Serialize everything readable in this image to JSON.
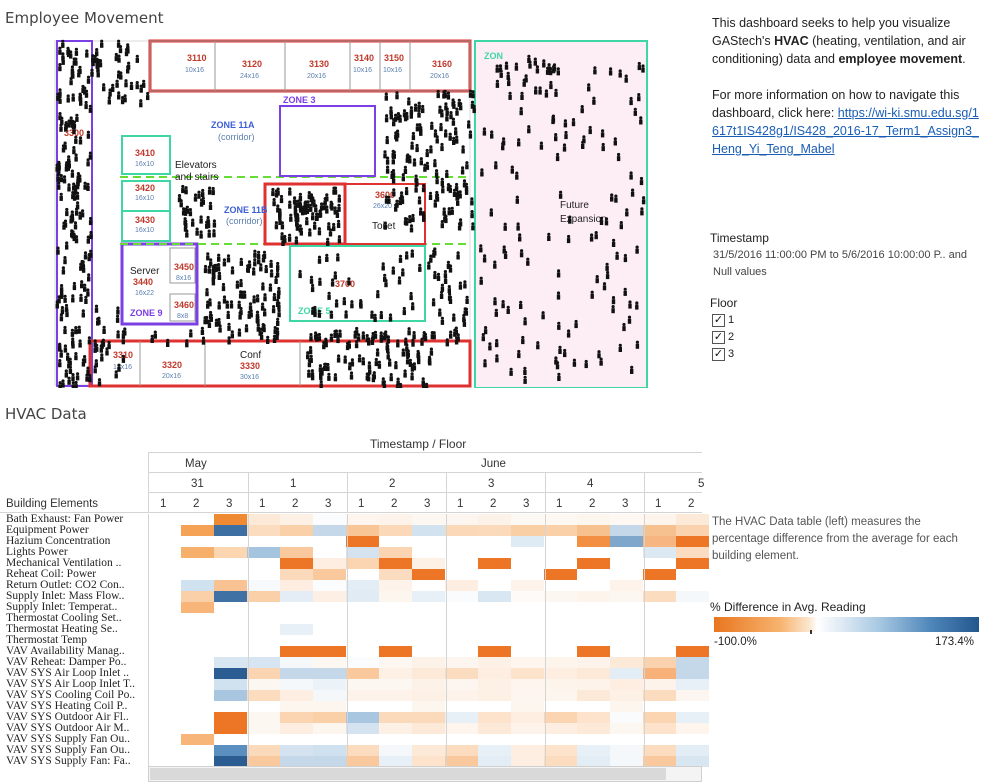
{
  "titles": {
    "movement": "Employee Movement",
    "hvac": "HVAC Data"
  },
  "info": {
    "intro_pre": "This dashboard seeks to help you visualize GAStech's ",
    "intro_hvac": "HVAC",
    "intro_mid": " (heating, ventilation, and air conditioning) data and ",
    "intro_move": "employee movement",
    "intro_end": ".",
    "more_pre": "For more information on how to navigate this dashboard, click here: ",
    "link_text": "https://wi-ki.smu.edu.sg/1617t1IS428g1/IS428_2016-17_Term1_Assign3_Heng_Yi_Teng_Mabel"
  },
  "filters": {
    "timestamp_title": "Timestamp",
    "timestamp_value": "31/5/2016 11:00:00 PM to 5/6/2016 10:00:00 P.. and Null values",
    "floor_title": "Floor",
    "floor_options": [
      {
        "label": "1",
        "checked": true
      },
      {
        "label": "2",
        "checked": true
      },
      {
        "label": "3",
        "checked": true
      }
    ]
  },
  "floorplan": {
    "rooms": [
      {
        "name": "3110",
        "size": "10x16"
      },
      {
        "name": "3120",
        "size": "24x16"
      },
      {
        "name": "3130",
        "size": "20x16"
      },
      {
        "name": "3140",
        "size": "10x16"
      },
      {
        "name": "3150",
        "size": "10x16"
      },
      {
        "name": "3160",
        "size": "20x16"
      },
      {
        "name": "3410",
        "size": "16x10"
      },
      {
        "name": "3420",
        "size": "16x10"
      },
      {
        "name": "3430",
        "size": "16x10"
      },
      {
        "name": "3440",
        "size": "16x22"
      },
      {
        "name": "3450",
        "size": "8x16"
      },
      {
        "name": "3460",
        "size": "8x8"
      },
      {
        "name": "3310",
        "size": "12x16"
      },
      {
        "name": "3320",
        "size": "20x16"
      },
      {
        "name": "3330",
        "size": "30x16"
      }
    ],
    "labels": {
      "zone3": "ZONE 3",
      "zone9": "ZONE 9",
      "zone5": "ZONE 5",
      "zone_top": "ZON",
      "zone11a": "ZONE 11A",
      "zone11a_sub": "(corridor)",
      "zone11b": "ZONE 11B",
      "zone11b_sub": "(corridor)",
      "elevators": "Elevators",
      "stairs": "and stairs",
      "server": "Server",
      "conf": "Conf",
      "toilet": "Toilet",
      "future1": "Future",
      "future2": "Expansion",
      "room3600": "3600",
      "room3600_size": "26x20",
      "room3700": "3700",
      "room3300": "3300"
    }
  },
  "hvac": {
    "header_title": "Timestamp / Floor",
    "row_header": "Building Elements",
    "months": [
      "May",
      "June"
    ],
    "days": [
      "31",
      "1",
      "2",
      "3",
      "4",
      "5"
    ],
    "floors": [
      "1",
      "2",
      "3",
      "1",
      "2",
      "3",
      "1",
      "2",
      "3",
      "1",
      "2",
      "3",
      "1",
      "2",
      "3",
      "1",
      "2"
    ],
    "rows": [
      "Bath Exhaust: Fan Power",
      "Equipment Power",
      "Hazium Concentration",
      "Lights Power",
      "Mechanical Ventilation ..",
      "Reheat Coil: Power",
      "Return Outlet: CO2 Con..",
      "Supply Inlet: Mass Flow..",
      "Supply Inlet: Temperat..",
      "Thermostat Cooling Set..",
      "Thermostat Heating Se..",
      "Thermostat Temp",
      "VAV Availability Manag..",
      "VAV Reheat: Damper Po..",
      "VAV SYS Air Loop Inlet ..",
      "VAV SYS Air Loop Inlet T..",
      "VAV SYS Cooling Coil Po..",
      "VAV SYS Heating Coil P..",
      "VAV SYS Outdoor Air Fl..",
      "VAV SYS Outdoor Air M..",
      "VAV SYS Supply Fan Ou..",
      "VAV SYS Supply Fan Ou..",
      "VAV SYS Supply Fan: Fa.."
    ],
    "cells": [
      [
        null,
        null,
        "#ef8a33",
        "#fde9d7",
        "#fdf1e6",
        "#fbfcfe",
        "#fdf5ee",
        "#fdf3ea",
        "#fdf7f1",
        "#fdf6f0",
        "#fdf2e8",
        "#fcf8f4",
        "#fef8f3",
        "#fdf6ef",
        "#fef7f2",
        "#fdf4ec",
        "#fde9d8"
      ],
      [
        null,
        "#f5a156",
        "#3d6fa3",
        "#fbdcbe",
        "#fad0a9",
        "#c4d8ea",
        "#f8c597",
        "#fbd8b8",
        "#d2e2ef",
        "#fad8b8",
        "#fbd9bb",
        "#f9cfa5",
        "#f9d0a7",
        "#f7c08f",
        "#c4d8ea",
        "#f7c08f",
        "#fad3ae"
      ],
      [
        null,
        null,
        null,
        null,
        null,
        null,
        "#ec7625",
        null,
        null,
        null,
        null,
        "#dfebf4",
        null,
        "#f28f43",
        "#7fa7cc",
        "#f7b681",
        "#ec7625"
      ],
      [
        null,
        "#f7b06b",
        "#fbd6b0",
        "#a4c4df",
        "#f9c89c",
        null,
        "#d5e3f0",
        "#fbd5b1",
        null,
        null,
        null,
        null,
        null,
        null,
        null,
        "#dce9f3",
        "#fbdcc0"
      ],
      [
        null,
        null,
        null,
        null,
        "#ec7625",
        "#fdeee1",
        "#fbd5b1",
        "#ec7625",
        "#fdf1e5",
        null,
        "#ec7625",
        null,
        null,
        "#ec7625",
        null,
        null,
        "#ec7625"
      ],
      [
        null,
        null,
        null,
        null,
        "#fbd9bb",
        "#f9c89c",
        null,
        "#fbdcc0",
        "#ec7625",
        null,
        null,
        null,
        "#ec7625",
        null,
        null,
        "#ec7625",
        null
      ],
      [
        null,
        "#d0e1ef",
        "#f9c293",
        "#f7fafd",
        "#fdeee1",
        "#fbfcfe",
        "#e3edf5",
        "#fdf3ea",
        null,
        "#fdeee1",
        null,
        "#fdf3ea",
        null,
        null,
        "#fdf3ea",
        null,
        null
      ],
      [
        null,
        "#fad0a8",
        "#3f71a5",
        "#fad0a8",
        "#e4edf6",
        "#fdefe3",
        "#e0ebf4",
        "#fdf6ef",
        "#e7f0f7",
        "#f9fbfd",
        "#d9e7f2",
        "#fdfaf7",
        "#fdf7f2",
        "#fdf4ec",
        "#fdf7f1",
        "#fbdcbf",
        "#f4f8fb"
      ],
      [
        null,
        "#f7b579",
        null,
        null,
        null,
        null,
        null,
        null,
        null,
        null,
        null,
        null,
        null,
        null,
        null,
        null,
        null
      ],
      [
        null,
        null,
        null,
        null,
        null,
        null,
        null,
        null,
        null,
        null,
        null,
        null,
        null,
        null,
        null,
        null,
        null
      ],
      [
        null,
        null,
        null,
        null,
        "#e7eff7",
        null,
        null,
        null,
        null,
        null,
        null,
        null,
        null,
        null,
        null,
        null,
        null
      ],
      [
        null,
        null,
        null,
        null,
        null,
        null,
        null,
        null,
        null,
        null,
        null,
        null,
        null,
        null,
        null,
        null,
        null
      ],
      [
        null,
        null,
        null,
        null,
        "#ec7625",
        "#ec7625",
        null,
        "#ec7625",
        null,
        null,
        "#ec7625",
        null,
        null,
        "#ec7625",
        null,
        null,
        "#ec7625"
      ],
      [
        null,
        null,
        "#d8e6f2",
        "#d6e5f1",
        "#f4f8fb",
        "#fdf7f1",
        "#fbfcfe",
        "#fdf7f1",
        "#fdf2e8",
        "#fdf6f0",
        "#fdf0e5",
        "#fdf5ee",
        "#fdf4ec",
        "#fdf3ea",
        "#fde9d8",
        "#fad3ae",
        "#c4d8ea"
      ],
      [
        null,
        null,
        "#2b5d92",
        "#fbd5b1",
        "#c4d8ea",
        "#c4d8ea",
        "#f9c89c",
        "#fdf1e5",
        "#fde9d8",
        "#fcdcbf",
        "#fdeee1",
        "#fde3cc",
        "#fdeee1",
        "#fde9d8",
        "#e3edf5",
        "#f7b179",
        "#c4d8ea"
      ],
      [
        null,
        null,
        "#d0e1ef",
        "#fdf7f1",
        "#f4f8fb",
        "#ecf3f8",
        "#fdf7f1",
        "#fdf7f1",
        "#fdf2e8",
        "#fdf6f0",
        "#fdf0e5",
        "#fdf5ee",
        "#fdf4ec",
        "#fdf3ea",
        "#fdeee1",
        "#fdf3ea",
        "#e7f0f7"
      ],
      [
        null,
        null,
        "#a8c6e0",
        "#fcdcbf",
        "#fdeee1",
        "#f4f8fb",
        "#fdf3ea",
        "#fdf3ea",
        "#fdf1e5",
        "#fdf3ea",
        "#fdf1e5",
        "#fdf6f0",
        "#fdf6ef",
        "#fde9d8",
        "#fdf1e5",
        "#fcdcbf",
        "#fdf6f0"
      ],
      [
        null,
        null,
        null,
        null,
        "#fdf6ef",
        "#fdf6ef",
        null,
        null,
        "#fdf6ef",
        null,
        null,
        "#fdf6ef",
        null,
        null,
        "#fdf6ef",
        null,
        null
      ],
      [
        null,
        null,
        "#ec7625",
        "#fdf7f1",
        "#fbd5b1",
        "#fad0a8",
        "#a8c6e0",
        "#fbd9bb",
        "#fbd9bb",
        "#e7eff7",
        "#fde3cc",
        "#fdeee1",
        "#fbd5b1",
        "#fde3cc",
        "#f9fbfd",
        "#fbd5b1",
        "#e7eff7"
      ],
      [
        null,
        null,
        "#ec7625",
        "#fdf7f1",
        "#fdeee1",
        "#fdf6ef",
        "#d5e3f0",
        "#fdf1e5",
        "#fde9d8",
        "#fdf5ee",
        "#fde9d8",
        "#fdf3ea",
        "#fdeee1",
        "#fde9d8",
        "#fdf7f1",
        "#fde3cc",
        "#fdf5ee"
      ],
      [
        null,
        "#f7b579",
        null,
        null,
        null,
        null,
        null,
        null,
        null,
        null,
        null,
        null,
        null,
        null,
        null,
        null,
        null
      ],
      [
        null,
        null,
        "#5b8fc0",
        "#fbd9bb",
        "#d5e3f0",
        "#cfe0ef",
        "#fcdcbf",
        "#f4f8fb",
        "#fde9d8",
        "#fcdcbf",
        "#e7eff7",
        "#fdeee1",
        "#fde3cc",
        "#e7eff7",
        "#f4f8fb",
        "#fcdcbf",
        "#e3edf5"
      ],
      [
        null,
        null,
        "#2b5d92",
        "#f9c89c",
        "#c4d8ea",
        "#c4d8ea",
        "#f9c89c",
        "#e7eff7",
        "#fde3cc",
        "#f9c89c",
        "#e3edf5",
        "#fdeee1",
        "#fcdcbf",
        "#e3edf5",
        "#f4f8fb",
        "#f9c89c",
        "#d8e6f2"
      ]
    ]
  },
  "legend": {
    "note": "The HVAC Data table (left) measures the percentage difference from the average for each building element.",
    "title": "% Difference in Avg. Reading",
    "min": "-100.0%",
    "max": "173.4%",
    "colors": {
      "negative": "#e8761f",
      "neutral": "#ffffff",
      "positive": "#23568e"
    }
  }
}
